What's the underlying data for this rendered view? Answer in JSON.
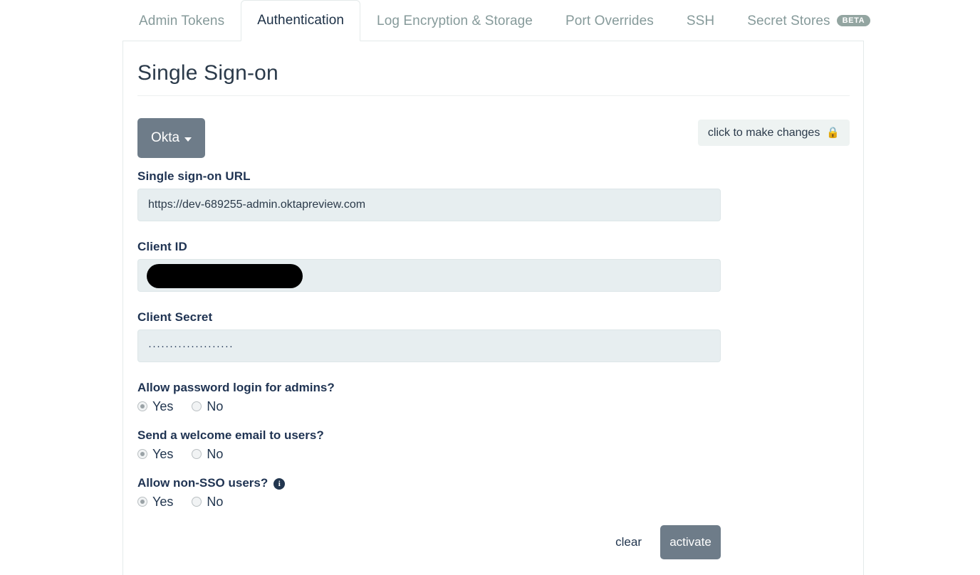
{
  "tabs": [
    {
      "label": "Admin Tokens",
      "active": false,
      "badge": null
    },
    {
      "label": "Authentication",
      "active": true,
      "badge": null
    },
    {
      "label": "Log Encryption & Storage",
      "active": false,
      "badge": null
    },
    {
      "label": "Port Overrides",
      "active": false,
      "badge": null
    },
    {
      "label": "SSH",
      "active": false,
      "badge": null
    },
    {
      "label": "Secret Stores",
      "active": false,
      "badge": "BETA"
    }
  ],
  "page": {
    "title": "Single Sign-on"
  },
  "provider": {
    "label": "Okta",
    "caret_icon": "chevron-down-icon"
  },
  "lock_button": {
    "label": "click to make changes",
    "icon": "lock-icon",
    "glyph": "🔒"
  },
  "fields": {
    "sso_url": {
      "label": "Single sign-on URL",
      "value": "https://dev-689255-admin.oktapreview.com"
    },
    "client_id": {
      "label": "Client ID",
      "value": "",
      "redacted": true
    },
    "client_secret": {
      "label": "Client Secret",
      "value": "····················"
    }
  },
  "questions": [
    {
      "label": "Allow password login for admins?",
      "info_icon": false,
      "yes_label": "Yes",
      "no_label": "No",
      "selected": "Yes"
    },
    {
      "label": "Send a welcome email to users?",
      "info_icon": false,
      "yes_label": "Yes",
      "no_label": "No",
      "selected": "Yes"
    },
    {
      "label": "Allow non-SSO users?",
      "info_icon": true,
      "info_glyph": "i",
      "yes_label": "Yes",
      "no_label": "No",
      "selected": "Yes"
    }
  ],
  "actions": {
    "clear_label": "clear",
    "activate_label": "activate"
  },
  "colors": {
    "accent_button": "#6e7c89",
    "active_tab_text": "#1b2f45",
    "inactive_tab_text": "#869a9a",
    "input_bg": "#e7eef0",
    "label_text": "#1f3352",
    "beta_badge_bg": "#93a5a1"
  }
}
